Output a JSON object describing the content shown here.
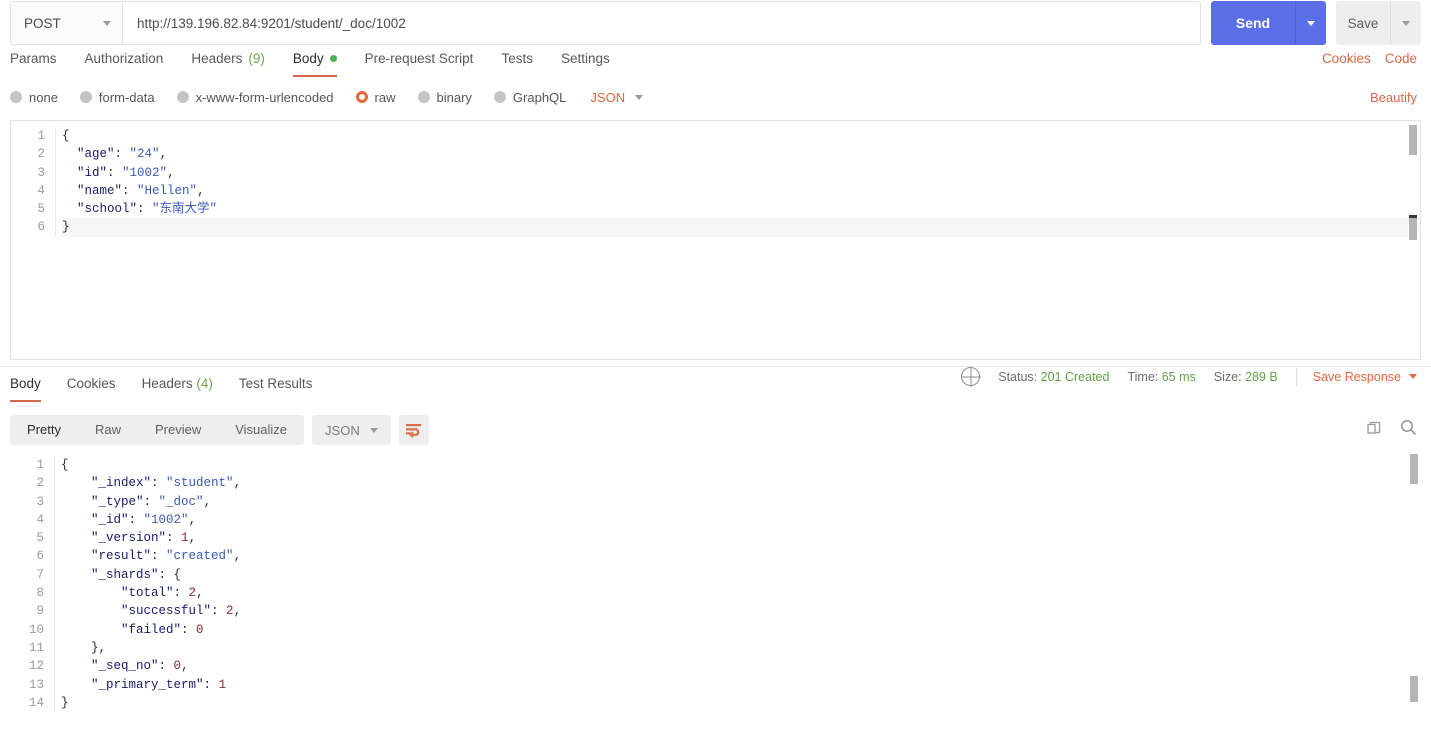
{
  "request": {
    "method": "POST",
    "url": "http://139.196.82.84:9201/student/_doc/1002",
    "send_label": "Send",
    "save_label": "Save",
    "tabs": [
      {
        "label": "Params",
        "count": "",
        "active": false,
        "dot": false
      },
      {
        "label": "Authorization",
        "count": "",
        "active": false,
        "dot": false
      },
      {
        "label": "Headers",
        "count": "(9)",
        "active": false,
        "dot": false
      },
      {
        "label": "Body",
        "count": "",
        "active": true,
        "dot": true
      },
      {
        "label": "Pre-request Script",
        "count": "",
        "active": false,
        "dot": false
      },
      {
        "label": "Tests",
        "count": "",
        "active": false,
        "dot": false
      },
      {
        "label": "Settings",
        "count": "",
        "active": false,
        "dot": false
      }
    ],
    "links": {
      "cookies": "Cookies",
      "code": "Code"
    },
    "body_types": [
      {
        "label": "none",
        "selected": false
      },
      {
        "label": "form-data",
        "selected": false
      },
      {
        "label": "x-www-form-urlencoded",
        "selected": false
      },
      {
        "label": "raw",
        "selected": true
      },
      {
        "label": "binary",
        "selected": false
      },
      {
        "label": "GraphQL",
        "selected": false
      }
    ],
    "raw_format": "JSON",
    "beautify_label": "Beautify",
    "body_lines": [
      {
        "n": "1",
        "html": "<span class=\"tok-punc\">{</span>"
      },
      {
        "n": "2",
        "html": "  <span class=\"tok-key\">\"age\"</span><span class=\"tok-punc\">: </span><span class=\"tok-str\">\"24\"</span><span class=\"tok-punc\">,</span>"
      },
      {
        "n": "3",
        "html": "  <span class=\"tok-key\">\"id\"</span><span class=\"tok-punc\">: </span><span class=\"tok-str\">\"1002\"</span><span class=\"tok-punc\">,</span>"
      },
      {
        "n": "4",
        "html": "  <span class=\"tok-key\">\"name\"</span><span class=\"tok-punc\">: </span><span class=\"tok-str\">\"Hellen\"</span><span class=\"tok-punc\">,</span>"
      },
      {
        "n": "5",
        "html": "  <span class=\"tok-key\">\"school\"</span><span class=\"tok-punc\">: </span><span class=\"tok-str\">\"东南大学\"</span>"
      },
      {
        "n": "6",
        "html": "<span class=\"tok-punc\">}</span>"
      }
    ],
    "body_text": "{\n  \"age\": \"24\",\n  \"id\": \"1002\",\n  \"name\": \"Hellen\",\n  \"school\": \"东南大学\"\n}"
  },
  "response": {
    "tabs": [
      {
        "label": "Body",
        "count": "",
        "active": true
      },
      {
        "label": "Cookies",
        "count": "",
        "active": false
      },
      {
        "label": "Headers",
        "count": "(4)",
        "active": false
      },
      {
        "label": "Test Results",
        "count": "",
        "active": false
      }
    ],
    "status": {
      "status_label": "Status:",
      "status_value": "201 Created",
      "time_label": "Time:",
      "time_value": "65 ms",
      "size_label": "Size:",
      "size_value": "289 B",
      "save_response": "Save Response"
    },
    "view_modes": [
      {
        "label": "Pretty",
        "active": true
      },
      {
        "label": "Raw",
        "active": false
      },
      {
        "label": "Preview",
        "active": false
      },
      {
        "label": "Visualize",
        "active": false
      }
    ],
    "format": "JSON",
    "body_lines": [
      {
        "n": "1",
        "html": "<span class=\"tok-punc\">{</span>"
      },
      {
        "n": "2",
        "html": "    <span class=\"tok-key\">\"_index\"</span><span class=\"tok-punc\">: </span><span class=\"tok-str\">\"student\"</span><span class=\"tok-punc\">,</span>"
      },
      {
        "n": "3",
        "html": "    <span class=\"tok-key\">\"_type\"</span><span class=\"tok-punc\">: </span><span class=\"tok-str\">\"_doc\"</span><span class=\"tok-punc\">,</span>"
      },
      {
        "n": "4",
        "html": "    <span class=\"tok-key\">\"_id\"</span><span class=\"tok-punc\">: </span><span class=\"tok-str\">\"1002\"</span><span class=\"tok-punc\">,</span>"
      },
      {
        "n": "5",
        "html": "    <span class=\"tok-key\">\"_version\"</span><span class=\"tok-punc\">: </span><span class=\"tok-num\">1</span><span class=\"tok-punc\">,</span>"
      },
      {
        "n": "6",
        "html": "    <span class=\"tok-key\">\"result\"</span><span class=\"tok-punc\">: </span><span class=\"tok-str\">\"created\"</span><span class=\"tok-punc\">,</span>"
      },
      {
        "n": "7",
        "html": "    <span class=\"tok-key\">\"_shards\"</span><span class=\"tok-punc\">: {</span>"
      },
      {
        "n": "8",
        "html": "        <span class=\"tok-key\">\"total\"</span><span class=\"tok-punc\">: </span><span class=\"tok-num\">2</span><span class=\"tok-punc\">,</span>"
      },
      {
        "n": "9",
        "html": "        <span class=\"tok-key\">\"successful\"</span><span class=\"tok-punc\">: </span><span class=\"tok-num\">2</span><span class=\"tok-punc\">,</span>"
      },
      {
        "n": "10",
        "html": "        <span class=\"tok-key\">\"failed\"</span><span class=\"tok-punc\">: </span><span class=\"tok-num\">0</span>"
      },
      {
        "n": "11",
        "html": "    <span class=\"tok-punc\">},</span>"
      },
      {
        "n": "12",
        "html": "    <span class=\"tok-key\">\"_seq_no\"</span><span class=\"tok-punc\">: </span><span class=\"tok-num\">0</span><span class=\"tok-punc\">,</span>"
      },
      {
        "n": "13",
        "html": "    <span class=\"tok-key\">\"_primary_term\"</span><span class=\"tok-punc\">: </span><span class=\"tok-num\">1</span>"
      },
      {
        "n": "14",
        "html": "<span class=\"tok-punc\">}</span>"
      }
    ],
    "body_text": "{\n    \"_index\": \"student\",\n    \"_type\": \"_doc\",\n    \"_id\": \"1002\",\n    \"_version\": 1,\n    \"result\": \"created\",\n    \"_shards\": {\n        \"total\": 2,\n        \"successful\": 2,\n        \"failed\": 0\n    },\n    \"_seq_no\": 0,\n    \"_primary_term\": 1\n}"
  },
  "colors": {
    "accent_orange": "#e4673b",
    "send_blue": "#5a6ee8",
    "status_green": "#5fa34a",
    "tab_underline": "#d4694a"
  }
}
